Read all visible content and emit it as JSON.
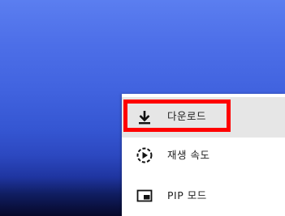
{
  "menu": {
    "items": [
      {
        "label": "다운로드",
        "icon": "download-icon",
        "highlighted": true
      },
      {
        "label": "재생 속도",
        "icon": "playback-speed-icon",
        "highlighted": false
      },
      {
        "label": "PIP 모드",
        "icon": "pip-icon",
        "highlighted": false
      }
    ]
  },
  "colors": {
    "highlight_box": "#ff0000",
    "menu_background": "#ffffff",
    "hover_background": "#e6e6e6"
  }
}
